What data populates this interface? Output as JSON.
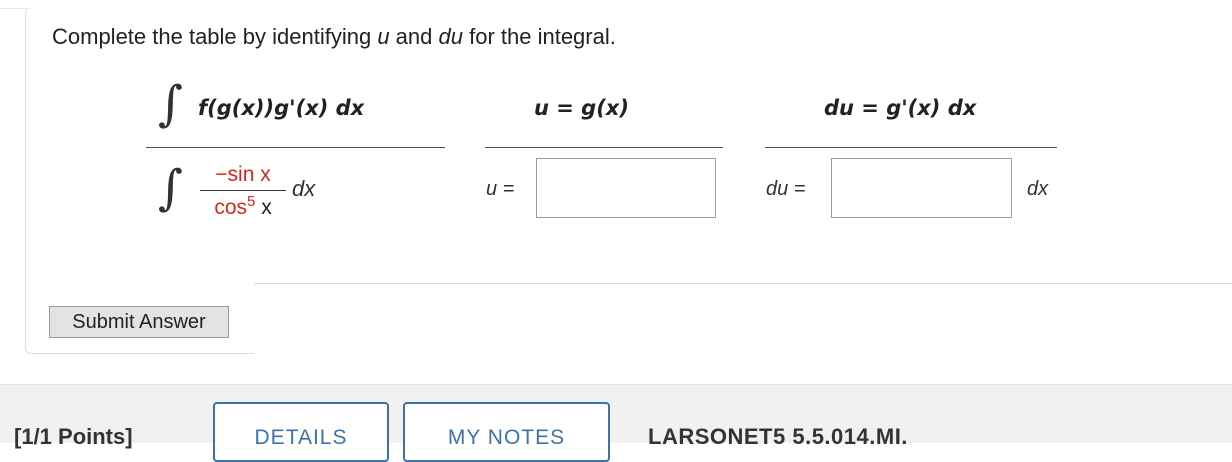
{
  "question": {
    "prompt_prefix": "Complete the table by identifying ",
    "prompt_u": "u",
    "prompt_and": " and ",
    "prompt_du": "du",
    "prompt_suffix": " for the integral."
  },
  "table": {
    "header_integral": "f(g(x))g'(x) dx",
    "header_u": "u = g(x)",
    "header_du": "du = g'(x) dx",
    "integral_numerator": "−sin x",
    "integral_denominator_base": "cos",
    "integral_denominator_exp": "5",
    "integral_denominator_var": "x",
    "integral_dx": "dx",
    "u_label": "u =",
    "du_label": "du =",
    "du_suffix": "dx",
    "u_value": "",
    "du_value": ""
  },
  "actions": {
    "submit_label": "Submit Answer"
  },
  "next_question": {
    "points": "[1/1 Points]",
    "details_label": "DETAILS",
    "notes_label": "MY NOTES",
    "code": "LARSONET5 5.5.014.MI."
  }
}
